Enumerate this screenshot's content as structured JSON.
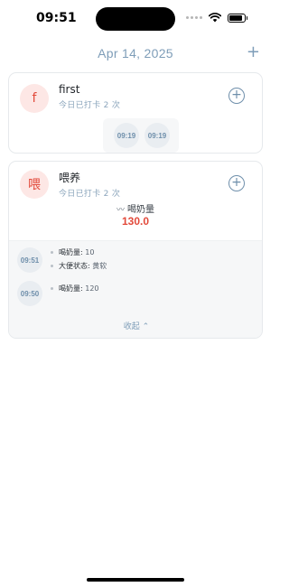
{
  "status_bar": {
    "time": "09:51"
  },
  "header": {
    "date": "Apr 14, 2025",
    "add_icon": "+"
  },
  "items": [
    {
      "avatar": "f",
      "title": "first",
      "subtitle": "今日已打卡 2 次",
      "add_icon": "plus-circle-icon",
      "times": [
        "09:19",
        "09:19"
      ]
    },
    {
      "avatar": "喂",
      "title": "喂养",
      "subtitle": "今日已打卡 2 次",
      "add_icon": "plus-circle-icon",
      "stat": {
        "trend_icon": "〰",
        "label": "喝奶量",
        "value": "130.0"
      },
      "records": [
        {
          "time": "09:51",
          "fields": [
            {
              "key": "喝奶量",
              "value": "10"
            },
            {
              "key": "大便状态",
              "value": "黄软"
            }
          ]
        },
        {
          "time": "09:50",
          "fields": [
            {
              "key": "喝奶量",
              "value": "120"
            }
          ]
        }
      ],
      "collapse_label": "收起 ⌃"
    }
  ],
  "colors": {
    "accent": "#7e9db8",
    "danger": "#e24a3b",
    "avatar_bg": "#fde7e5"
  }
}
